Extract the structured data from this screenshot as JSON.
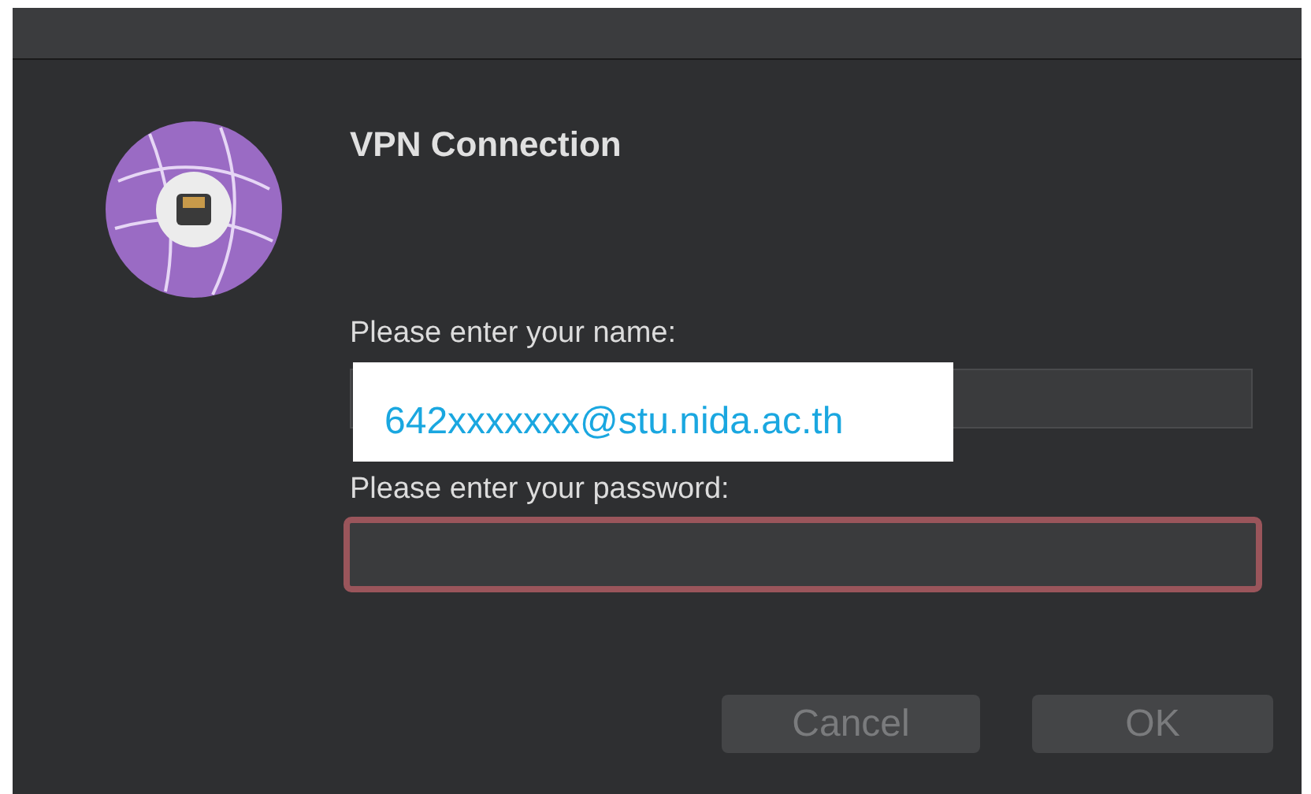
{
  "dialog": {
    "title": "VPN Connection"
  },
  "name_field": {
    "label": "Please enter your name:",
    "focused": false
  },
  "annotation": {
    "text": "642xxxxxxx@stu.nida.ac.th"
  },
  "password_field": {
    "label": "Please enter your password:",
    "focused": true
  },
  "buttons": [
    {
      "label": "Cancel",
      "disabled": true
    },
    {
      "label": "OK",
      "disabled": true
    }
  ]
}
